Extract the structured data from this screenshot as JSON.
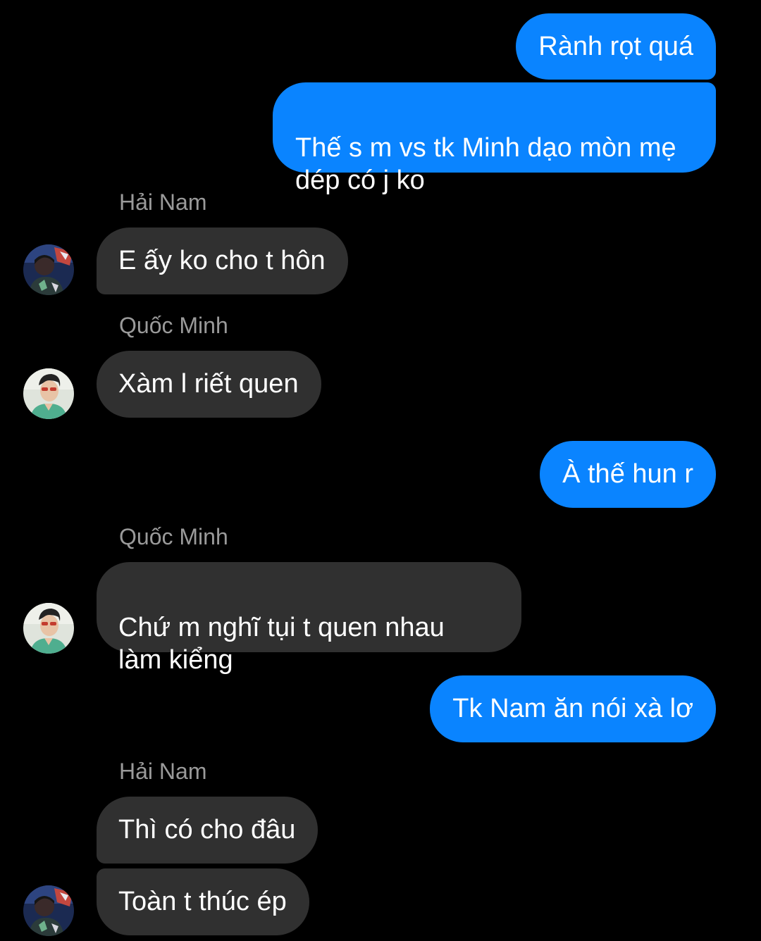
{
  "conversation": {
    "messages": [
      {
        "direction": "outgoing",
        "text": "Rành rọt quá"
      },
      {
        "direction": "outgoing",
        "text": "Thế s m vs tk Minh dạo mòn mẹ\ndép có j ko"
      },
      {
        "direction": "incoming",
        "sender": "Hải Nam",
        "text": "E ấy ko cho t hôn"
      },
      {
        "direction": "incoming",
        "sender": "Quốc Minh",
        "text": "Xàm l riết quen"
      },
      {
        "direction": "outgoing",
        "text": "À thế hun r"
      },
      {
        "direction": "incoming",
        "sender": "Quốc Minh",
        "text": "Chứ m nghĩ tụi t quen nhau\nlàm kiểng"
      },
      {
        "direction": "outgoing",
        "text": "Tk Nam ăn nói xà lơ"
      },
      {
        "direction": "incoming",
        "sender": "Hải Nam",
        "text": "Thì có cho đâu"
      },
      {
        "direction": "incoming",
        "text": "Toàn t thúc ép"
      }
    ]
  },
  "colors": {
    "background": "#000000",
    "outgoing_bubble": "#0a84ff",
    "incoming_bubble": "#303030",
    "sender_name": "#9a9a9a",
    "message_text": "#ffffff"
  }
}
